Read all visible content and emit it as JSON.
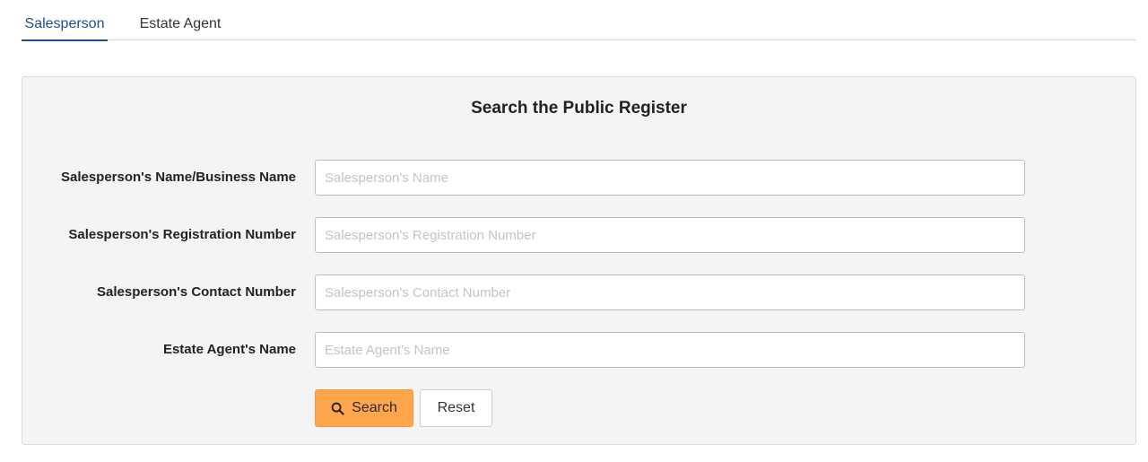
{
  "tabs": [
    {
      "label": "Salesperson",
      "active": true
    },
    {
      "label": "Estate Agent",
      "active": false
    }
  ],
  "panel": {
    "title": "Search the Public Register"
  },
  "form": {
    "fields": [
      {
        "label": "Salesperson's Name/Business Name",
        "placeholder": "Salesperson's Name",
        "value": ""
      },
      {
        "label": "Salesperson's Registration Number",
        "placeholder": "Salesperson's Registration Number",
        "value": ""
      },
      {
        "label": "Salesperson's Contact Number",
        "placeholder": "Salesperson's Contact Number",
        "value": ""
      },
      {
        "label": "Estate Agent's Name",
        "placeholder": "Estate Agent's Name",
        "value": ""
      }
    ],
    "search_label": "Search",
    "reset_label": "Reset",
    "search_icon": "search-icon"
  },
  "colors": {
    "accent": "#1d4e8f",
    "search_button": "#ffa64d",
    "panel_bg": "#f4f4f4"
  }
}
